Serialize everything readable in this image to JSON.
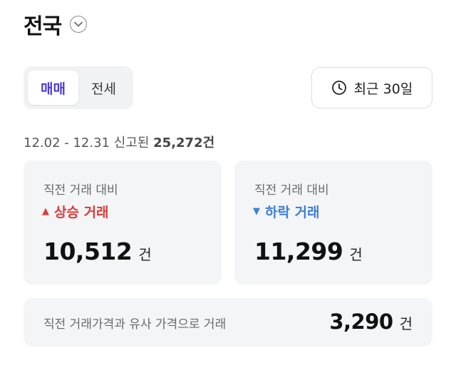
{
  "header": {
    "title": "전국",
    "chevron_icon": "chevron-down-icon"
  },
  "tabs": [
    {
      "label": "매매",
      "active": true
    },
    {
      "label": "전세",
      "active": false
    }
  ],
  "period": {
    "label": "최근 30일",
    "icon": "clock-icon"
  },
  "summary": {
    "range": "12.02 - 12.31 신고된",
    "count": "25,272건"
  },
  "cards": {
    "up": {
      "label": "직전 거래 대비",
      "trend": "상승 거래",
      "marker": "▲",
      "value": "10,512",
      "unit": "건",
      "color": "#e03a3a"
    },
    "down": {
      "label": "직전 거래 대비",
      "trend": "하락 거래",
      "marker": "▼",
      "value": "11,299",
      "unit": "건",
      "color": "#3c7fd6"
    }
  },
  "similar": {
    "label": "직전 거래가격과 유사 가격으로 거래",
    "value": "3,290",
    "unit": "건"
  },
  "colors": {
    "accent": "#4f39d6",
    "up": "#e03a3a",
    "down": "#3c7fd6"
  }
}
